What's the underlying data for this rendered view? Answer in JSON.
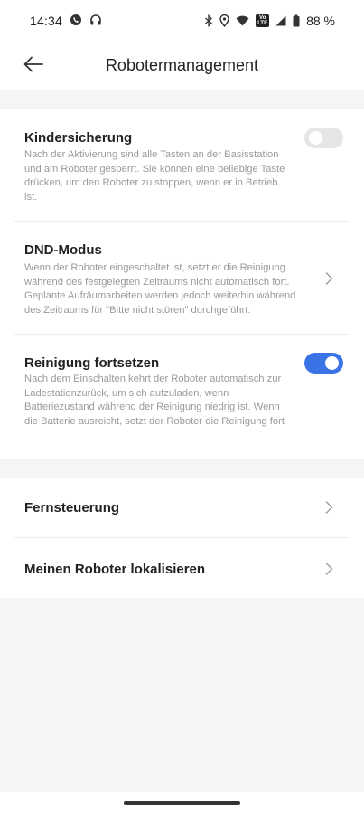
{
  "status_bar": {
    "time": "14:34",
    "left_icons": [
      "whatsapp-icon",
      "headphones-icon"
    ],
    "right_icons": [
      "bluetooth-icon",
      "location-icon",
      "wifi-icon",
      "volte-icon",
      "signal-icon",
      "battery-icon"
    ],
    "volte_text": "Vo\nLTE",
    "battery": "88 %"
  },
  "header": {
    "title": "Robotermanagement",
    "back_icon": "arrow-left-icon"
  },
  "settings": [
    {
      "title": "Kindersicherung",
      "description": "Nach der Aktivierung sind alle Tasten an der Basisstation und am Roboter gesperrt. Sie können eine beliebige Taste drücken, um den Roboter zu stoppen, wenn er in Betrieb ist.",
      "control": "toggle",
      "enabled": false
    },
    {
      "title": "DND-Modus",
      "description": "Wenn der Roboter eingeschaltet ist, setzt er die Reinigung während des festgelegten Zeitraums nicht automatisch fort. Geplante Aufräumarbeiten werden jedoch weiterhin während des Zeitraums für \"Bitte nicht stören\" durchgeführt.",
      "control": "chevron"
    },
    {
      "title": "Reinigung fortsetzen",
      "description": "Nach dem Einschalten kehrt der Roboter automatisch zur Ladestationzurück, um sich aufzuladen, wenn Batteriezustand während der Reinigung niedrig ist. Wenn die Batterie ausreicht, setzt der Roboter die Reinigung fort",
      "control": "toggle",
      "enabled": true
    }
  ],
  "links": [
    {
      "title": "Fernsteuerung",
      "control": "chevron"
    },
    {
      "title": "Meinen Roboter lokalisieren",
      "control": "chevron"
    }
  ],
  "colors": {
    "accent": "#3a73e6",
    "background": "#f5f5f5",
    "card": "#ffffff",
    "muted_text": "#9a9a9a"
  }
}
